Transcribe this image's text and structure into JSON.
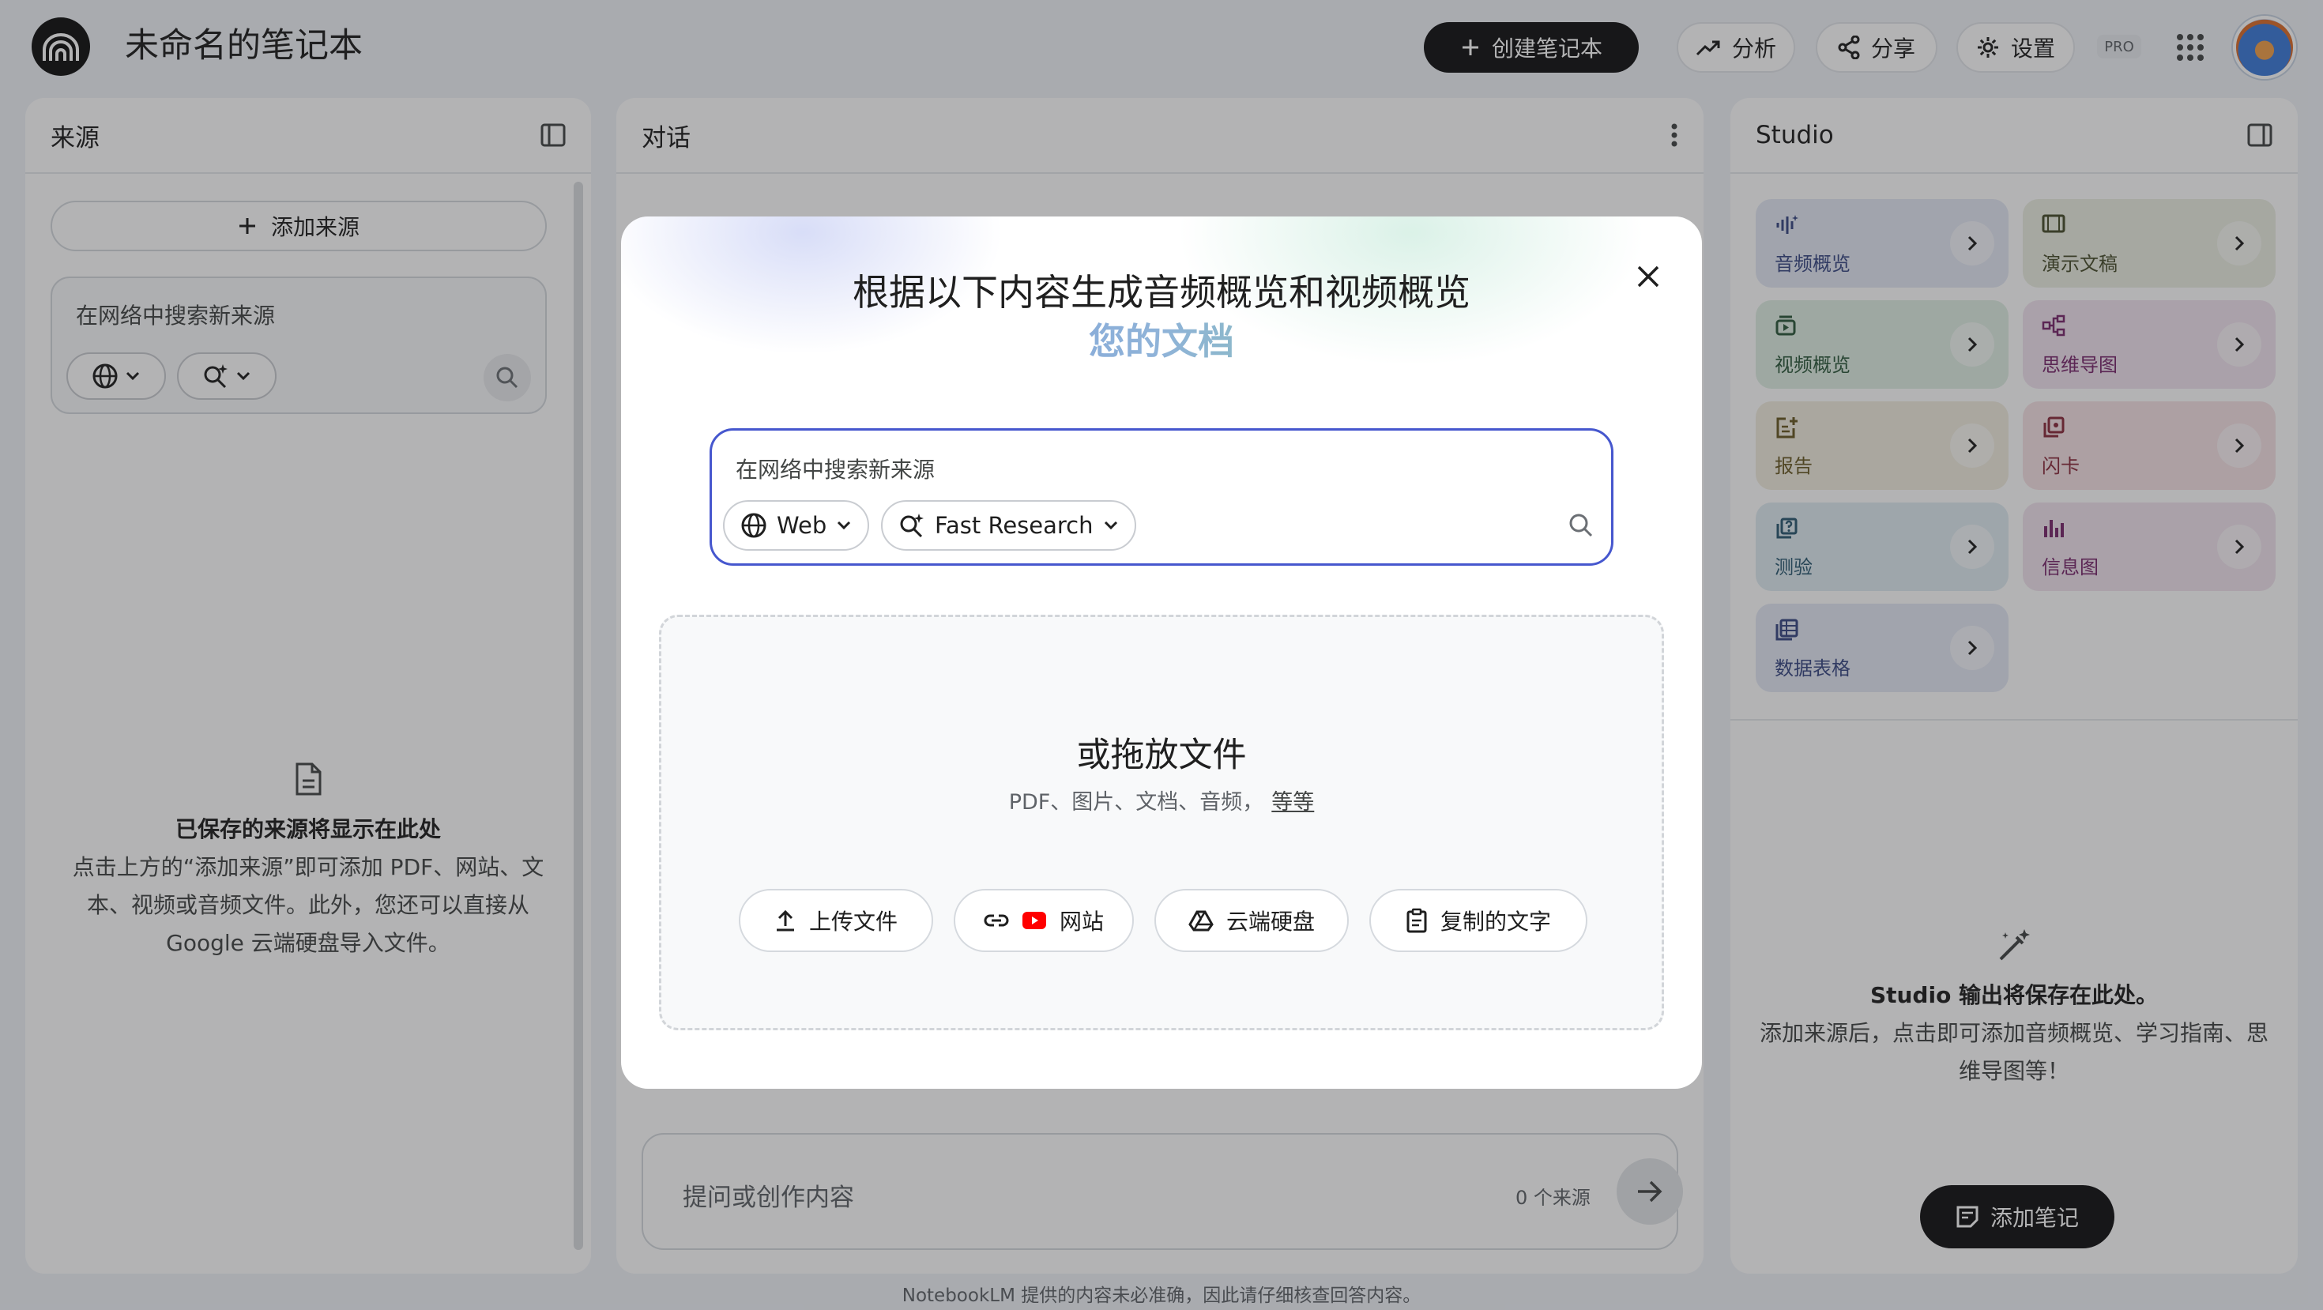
{
  "header": {
    "notebook_title": "未命名的笔记本",
    "create_label": "创建笔记本",
    "analytics_label": "分析",
    "share_label": "分享",
    "settings_label": "设置",
    "pro_badge": "PRO"
  },
  "sources": {
    "title": "来源",
    "add_label": "添加来源",
    "search_placeholder": "在网络中搜索新来源",
    "empty_title": "已保存的来源将显示在此处",
    "empty_line1": "点击上方的“添加来源”即可添加 PDF、网站、文",
    "empty_line2": "本、视频或音频文件。此外，您还可以直接从",
    "empty_line3": "Google 云端硬盘导入文件。"
  },
  "chat": {
    "title": "对话",
    "input_placeholder": "提问或创作内容",
    "source_count": "0 个来源"
  },
  "studio": {
    "title": "Studio",
    "tiles": [
      {
        "label": "音频概览",
        "icon": "audio-overview-icon",
        "bg": "#e4e9f5",
        "fg": "#3a4a84"
      },
      {
        "label": "演示文稿",
        "icon": "slides-icon",
        "bg": "#eceee3",
        "fg": "#4a4f2e"
      },
      {
        "label": "视频概览",
        "icon": "video-overview-icon",
        "bg": "#dfeee4",
        "fg": "#2e5a3d"
      },
      {
        "label": "思维导图",
        "icon": "mind-map-icon",
        "bg": "#f2e4f0",
        "fg": "#7a2a6e"
      },
      {
        "label": "报告",
        "icon": "report-icon",
        "bg": "#f1ede0",
        "fg": "#6a5a25"
      },
      {
        "label": "闪卡",
        "icon": "flashcard-icon",
        "bg": "#f6e3e6",
        "fg": "#8a2d3e"
      },
      {
        "label": "测验",
        "icon": "quiz-icon",
        "bg": "#dfecf2",
        "fg": "#2c5a72"
      },
      {
        "label": "信息图",
        "icon": "infographic-icon",
        "bg": "#f1e4ee",
        "fg": "#7a2a6e"
      },
      {
        "label": "数据表格",
        "icon": "data-table-icon",
        "bg": "#e4e9f5",
        "fg": "#3a4a84"
      }
    ],
    "empty_title": "Studio 输出将保存在此处。",
    "empty_desc": "添加来源后，点击即可添加音频概览、学习指南、思维导图等！",
    "add_note_label": "添加笔记"
  },
  "footer": {
    "disclaimer": "NotebookLM 提供的内容未必准确，因此请仔细核查回答内容。"
  },
  "modal": {
    "title": "根据以下内容生成音频概览和视频概览",
    "subtitle": "您的文档",
    "search_placeholder": "在网络中搜索新来源",
    "source_type": "Web",
    "research_mode": "Fast Research",
    "drop_title": "或拖放文件",
    "drop_types": "PDF、图片、文档、音频，",
    "drop_more": "等等",
    "upload_label": "上传文件",
    "website_label": "网站",
    "drive_label": "云端硬盘",
    "paste_label": "复制的文字"
  }
}
